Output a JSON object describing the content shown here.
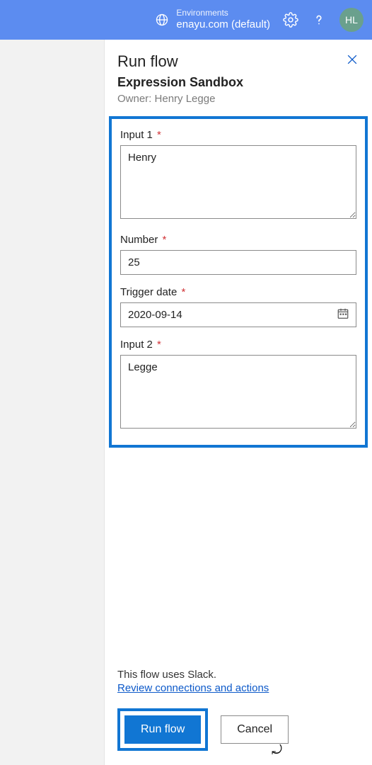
{
  "topbar": {
    "env_label": "Environments",
    "env_name": "enayu.com (default)",
    "avatar_initials": "HL"
  },
  "panel": {
    "title": "Run flow",
    "subtitle": "Expression Sandbox",
    "owner": "Owner: Henry Legge"
  },
  "form": {
    "input1": {
      "label": "Input 1",
      "value": "Henry"
    },
    "number": {
      "label": "Number",
      "value": "25"
    },
    "trigger_date": {
      "label": "Trigger date",
      "value": "2020-09-14"
    },
    "input2": {
      "label": "Input 2",
      "value": "Legge"
    },
    "required_marker": "*"
  },
  "footer": {
    "uses_text": "This flow uses Slack.",
    "review_link": "Review connections and actions",
    "run_label": "Run flow",
    "cancel_label": "Cancel"
  }
}
